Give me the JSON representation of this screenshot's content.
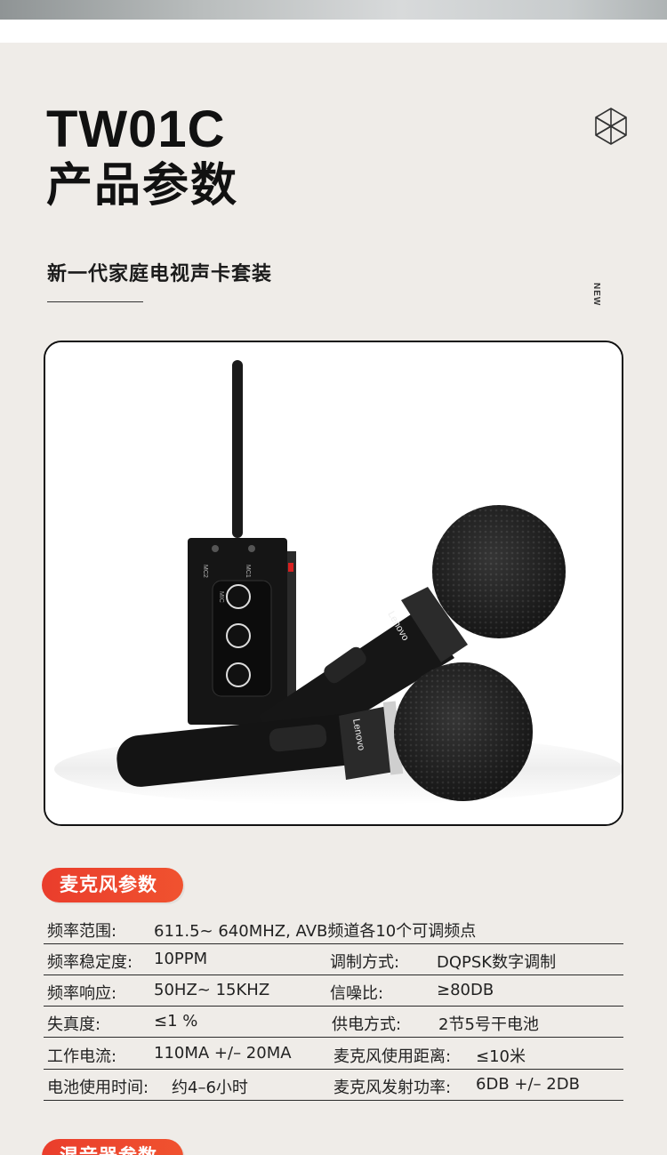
{
  "header": {
    "model": "TW01C",
    "title": "产品参数",
    "subtitle": "新一代家庭电视声卡套装",
    "tag": "NEW"
  },
  "product_image": {
    "brand_on_mic": "Lenovo",
    "receiver_labels": [
      "MC2",
      "MC1",
      "MIC"
    ]
  },
  "sections": {
    "mic_params": "麦克风参数",
    "mixer_params": "混音器参数"
  },
  "specs": [
    {
      "label1": "频率范围:",
      "value1": "611.5~ 640MHZ, AVB频道各10个可调频点",
      "label2": "",
      "value2": ""
    },
    {
      "label1": "频率稳定度:",
      "value1": "10PPM",
      "label2": "调制方式:",
      "value2": "DQPSK数字调制"
    },
    {
      "label1": "频率响应:",
      "value1": "50HZ~ 15KHZ",
      "label2": "信噪比:",
      "value2": "≥80DB"
    },
    {
      "label1": "失真度:",
      "value1": "≤1 %",
      "label2": "供电方式:",
      "value2": "2节5号干电池"
    },
    {
      "label1": "工作电流:",
      "value1": "110MA +/– 20MA",
      "label2": "麦克风使用距离:",
      "value2": "≤10米"
    },
    {
      "label1": "电池使用时间:",
      "value1": "约4–6小时",
      "label2": "麦克风发射功率:",
      "value2": "6DB +/– 2DB"
    }
  ],
  "colors": {
    "accent": "#ea3d2c",
    "background": "#efece8"
  }
}
